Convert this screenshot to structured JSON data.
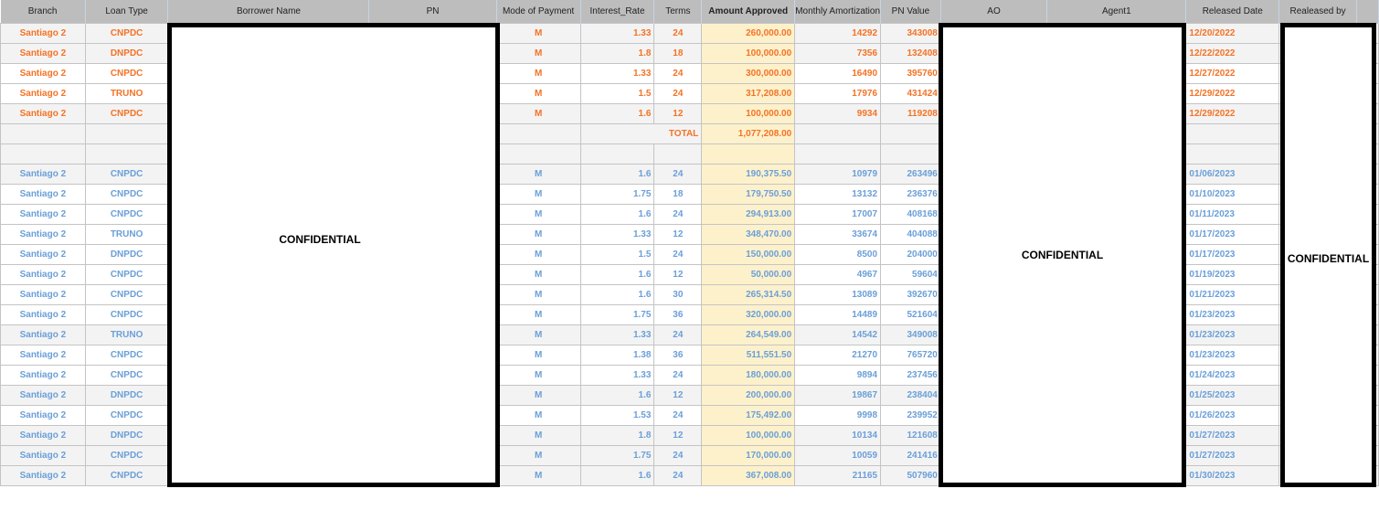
{
  "headers": [
    "Branch",
    "Loan Type",
    "Borrower Name",
    "PN",
    "Mode of Payment",
    "Interest_Rate",
    "Terms",
    "Amount Approved",
    "Monthly Amortization",
    "PN Value",
    "AO",
    "Agent1",
    "Released Date",
    "Realeased by",
    ""
  ],
  "confidential_label": "CONFIDENTIAL",
  "total_label": "TOTAL",
  "total_amount": "1,077,208.00",
  "colors": {
    "orange": "#f57224",
    "blue": "#6a9fd8",
    "amount_bg": "#fdf1cc",
    "header_bg": "#bdbdbd"
  },
  "rows_2022": [
    {
      "branch": "Santiago 2",
      "loan_type": "CNPDC",
      "mode": "M",
      "rate": "1.33",
      "terms": "24",
      "amount": "260,000.00",
      "monthly": "14292",
      "pn_value": "343008",
      "date": "12/20/2022",
      "alt": true
    },
    {
      "branch": "Santiago 2",
      "loan_type": "DNPDC",
      "mode": "M",
      "rate": "1.8",
      "terms": "18",
      "amount": "100,000.00",
      "monthly": "7356",
      "pn_value": "132408",
      "date": "12/22/2022",
      "alt": true
    },
    {
      "branch": "Santiago 2",
      "loan_type": "CNPDC",
      "mode": "M",
      "rate": "1.33",
      "terms": "24",
      "amount": "300,000.00",
      "monthly": "16490",
      "pn_value": "395760",
      "date": "12/27/2022",
      "alt": false
    },
    {
      "branch": "Santiago 2",
      "loan_type": "TRUNO",
      "mode": "M",
      "rate": "1.5",
      "terms": "24",
      "amount": "317,208.00",
      "monthly": "17976",
      "pn_value": "431424",
      "date": "12/29/2022",
      "alt": false
    },
    {
      "branch": "Santiago 2",
      "loan_type": "CNPDC",
      "mode": "M",
      "rate": "1.6",
      "terms": "12",
      "amount": "100,000.00",
      "monthly": "9934",
      "pn_value": "119208",
      "date": "12/29/2022",
      "alt": true
    }
  ],
  "rows_2023": [
    {
      "branch": "Santiago 2",
      "loan_type": "CNPDC",
      "mode": "M",
      "rate": "1.6",
      "terms": "24",
      "amount": "190,375.50",
      "monthly": "10979",
      "pn_value": "263496",
      "date": "01/06/2023",
      "alt": true
    },
    {
      "branch": "Santiago 2",
      "loan_type": "CNPDC",
      "mode": "M",
      "rate": "1.75",
      "terms": "18",
      "amount": "179,750.50",
      "monthly": "13132",
      "pn_value": "236376",
      "date": "01/10/2023",
      "alt": false
    },
    {
      "branch": "Santiago 2",
      "loan_type": "CNPDC",
      "mode": "M",
      "rate": "1.6",
      "terms": "24",
      "amount": "294,913.00",
      "monthly": "17007",
      "pn_value": "408168",
      "date": "01/11/2023",
      "alt": false
    },
    {
      "branch": "Santiago 2",
      "loan_type": "TRUNO",
      "mode": "M",
      "rate": "1.33",
      "terms": "12",
      "amount": "348,470.00",
      "monthly": "33674",
      "pn_value": "404088",
      "date": "01/17/2023",
      "alt": false
    },
    {
      "branch": "Santiago 2",
      "loan_type": "DNPDC",
      "mode": "M",
      "rate": "1.5",
      "terms": "24",
      "amount": "150,000.00",
      "monthly": "8500",
      "pn_value": "204000",
      "date": "01/17/2023",
      "alt": false
    },
    {
      "branch": "Santiago 2",
      "loan_type": "CNPDC",
      "mode": "M",
      "rate": "1.6",
      "terms": "12",
      "amount": "50,000.00",
      "monthly": "4967",
      "pn_value": "59604",
      "date": "01/19/2023",
      "alt": false
    },
    {
      "branch": "Santiago 2",
      "loan_type": "CNPDC",
      "mode": "M",
      "rate": "1.6",
      "terms": "30",
      "amount": "265,314.50",
      "monthly": "13089",
      "pn_value": "392670",
      "date": "01/21/2023",
      "alt": false
    },
    {
      "branch": "Santiago 2",
      "loan_type": "CNPDC",
      "mode": "M",
      "rate": "1.75",
      "terms": "36",
      "amount": "320,000.00",
      "monthly": "14489",
      "pn_value": "521604",
      "date": "01/23/2023",
      "alt": false
    },
    {
      "branch": "Santiago 2",
      "loan_type": "TRUNO",
      "mode": "M",
      "rate": "1.33",
      "terms": "24",
      "amount": "264,549.00",
      "monthly": "14542",
      "pn_value": "349008",
      "date": "01/23/2023",
      "alt": true
    },
    {
      "branch": "Santiago 2",
      "loan_type": "CNPDC",
      "mode": "M",
      "rate": "1.38",
      "terms": "36",
      "amount": "511,551.50",
      "monthly": "21270",
      "pn_value": "765720",
      "date": "01/23/2023",
      "alt": false
    },
    {
      "branch": "Santiago 2",
      "loan_type": "CNPDC",
      "mode": "M",
      "rate": "1.33",
      "terms": "24",
      "amount": "180,000.00",
      "monthly": "9894",
      "pn_value": "237456",
      "date": "01/24/2023",
      "alt": false
    },
    {
      "branch": "Santiago 2",
      "loan_type": "DNPDC",
      "mode": "M",
      "rate": "1.6",
      "terms": "12",
      "amount": "200,000.00",
      "monthly": "19867",
      "pn_value": "238404",
      "date": "01/25/2023",
      "alt": true
    },
    {
      "branch": "Santiago 2",
      "loan_type": "CNPDC",
      "mode": "M",
      "rate": "1.53",
      "terms": "24",
      "amount": "175,492.00",
      "monthly": "9998",
      "pn_value": "239952",
      "date": "01/26/2023",
      "alt": false
    },
    {
      "branch": "Santiago 2",
      "loan_type": "DNPDC",
      "mode": "M",
      "rate": "1.8",
      "terms": "12",
      "amount": "100,000.00",
      "monthly": "10134",
      "pn_value": "121608",
      "date": "01/27/2023",
      "alt": true
    },
    {
      "branch": "Santiago 2",
      "loan_type": "CNPDC",
      "mode": "M",
      "rate": "1.75",
      "terms": "24",
      "amount": "170,000.00",
      "monthly": "10059",
      "pn_value": "241416",
      "date": "01/27/2023",
      "alt": true
    },
    {
      "branch": "Santiago 2",
      "loan_type": "CNPDC",
      "mode": "M",
      "rate": "1.6",
      "terms": "24",
      "amount": "367,008.00",
      "monthly": "21165",
      "pn_value": "507960",
      "date": "01/30/2023",
      "alt": true
    }
  ]
}
